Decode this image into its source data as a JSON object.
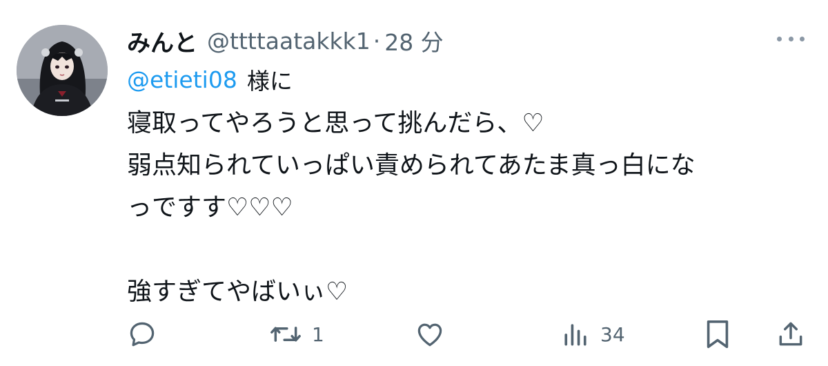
{
  "user": {
    "display_name": "みんと",
    "handle": "@ttttaatakkk1",
    "separator": "·",
    "time": "28 分"
  },
  "reply": {
    "mention": "@etieti08",
    "suffix": "様に"
  },
  "body_lines": [
    "寝取ってやろうと思って挑んだら、♡",
    "弱点知られていっぱい責められてあたま真っ白にな",
    "っですす♡♡♡",
    "",
    "強すぎてやばいぃ♡"
  ],
  "actions": {
    "reply": {
      "icon": "reply-icon",
      "count": ""
    },
    "retweet": {
      "icon": "retweet-icon",
      "count": "1"
    },
    "like": {
      "icon": "heart-icon",
      "count": ""
    },
    "views": {
      "icon": "views-icon",
      "count": "34"
    },
    "bookmark": {
      "icon": "bookmark-icon",
      "count": ""
    },
    "share": {
      "icon": "share-icon",
      "count": ""
    }
  },
  "colors": {
    "text": "#0f1419",
    "secondary": "#536471",
    "link": "#1d9bf0",
    "icon": "#536471"
  }
}
